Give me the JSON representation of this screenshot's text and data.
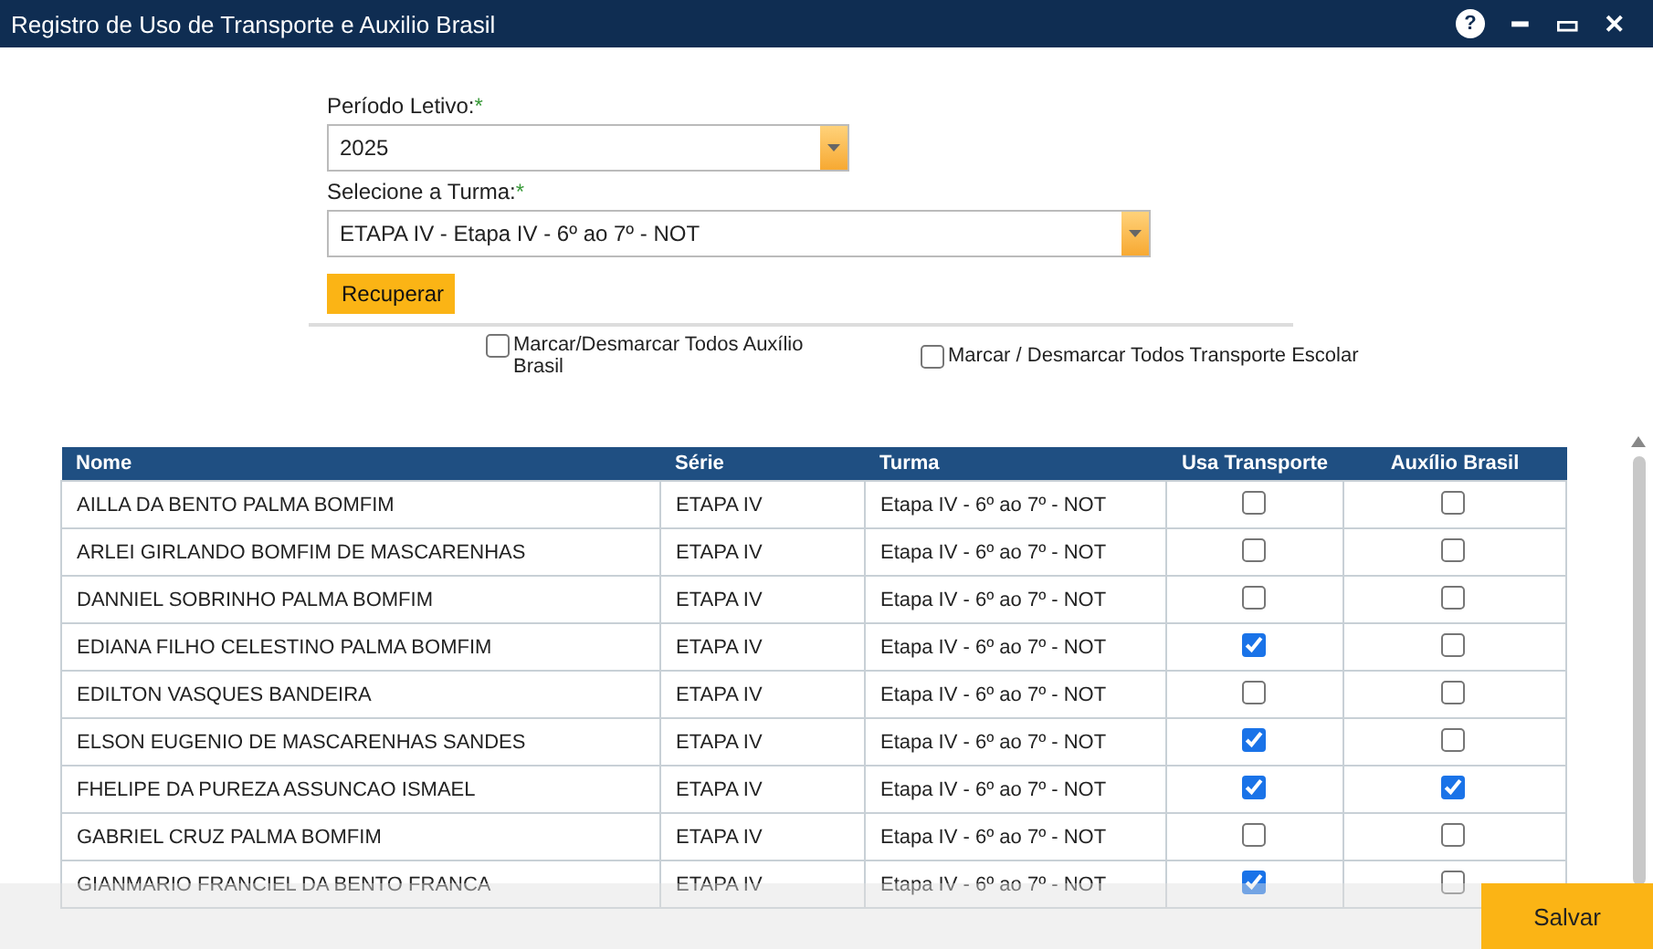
{
  "window": {
    "title": "Registro de Uso de Transporte e Auxilio Brasil",
    "controls": [
      "?",
      "━",
      "▭",
      "✕"
    ]
  },
  "form": {
    "period_label": "Período Letivo:",
    "period_required": "*",
    "period_value": "2025",
    "class_label": "Selecione a Turma:",
    "class_required": "*",
    "class_value": "ETAPA IV - Etapa IV - 6º ao 7º - NOT",
    "retrieve_button": "Recuperar"
  },
  "toggle_all": [
    {
      "label": "Marcar/Desmarcar Todos Auxílio Brasil",
      "checked": false
    },
    {
      "label": "Marcar / Desmarcar Todos Transporte Escolar",
      "checked": false
    }
  ],
  "table": {
    "columns": [
      "Nome",
      "Série",
      "Turma",
      "Usa Transporte",
      "Auxílio Brasil"
    ],
    "rows": [
      {
        "nome": "AILLA DA BENTO PALMA BOMFIM",
        "serie": "ETAPA IV",
        "turma": "Etapa IV - 6º ao 7º - NOT",
        "transporte": false,
        "auxilio": false
      },
      {
        "nome": "ARLEI GIRLANDO BOMFIM DE MASCARENHAS",
        "serie": "ETAPA IV",
        "turma": "Etapa IV - 6º ao 7º - NOT",
        "transporte": false,
        "auxilio": false
      },
      {
        "nome": "DANNIEL SOBRINHO PALMA BOMFIM",
        "serie": "ETAPA IV",
        "turma": "Etapa IV - 6º ao 7º - NOT",
        "transporte": false,
        "auxilio": false
      },
      {
        "nome": "EDIANA FILHO CELESTINO PALMA BOMFIM",
        "serie": "ETAPA IV",
        "turma": "Etapa IV - 6º ao 7º - NOT",
        "transporte": true,
        "auxilio": false
      },
      {
        "nome": "EDILTON VASQUES BANDEIRA",
        "serie": "ETAPA IV",
        "turma": "Etapa IV - 6º ao 7º - NOT",
        "transporte": false,
        "auxilio": false
      },
      {
        "nome": "ELSON EUGENIO DE MASCARENHAS SANDES",
        "serie": "ETAPA IV",
        "turma": "Etapa IV - 6º ao 7º - NOT",
        "transporte": true,
        "auxilio": false
      },
      {
        "nome": "FHELIPE DA PUREZA ASSUNCAO ISMAEL",
        "serie": "ETAPA IV",
        "turma": "Etapa IV - 6º ao 7º - NOT",
        "transporte": true,
        "auxilio": true
      },
      {
        "nome": "GABRIEL CRUZ PALMA BOMFIM",
        "serie": "ETAPA IV",
        "turma": "Etapa IV - 6º ao 7º - NOT",
        "transporte": false,
        "auxilio": false
      },
      {
        "nome": "GIANMARIO FRANCIEL DA BENTO FRANCA",
        "serie": "ETAPA IV",
        "turma": "Etapa IV - 6º ao 7º - NOT",
        "transporte": true,
        "auxilio": false
      }
    ]
  },
  "footer": {
    "save_button": "Salvar"
  }
}
